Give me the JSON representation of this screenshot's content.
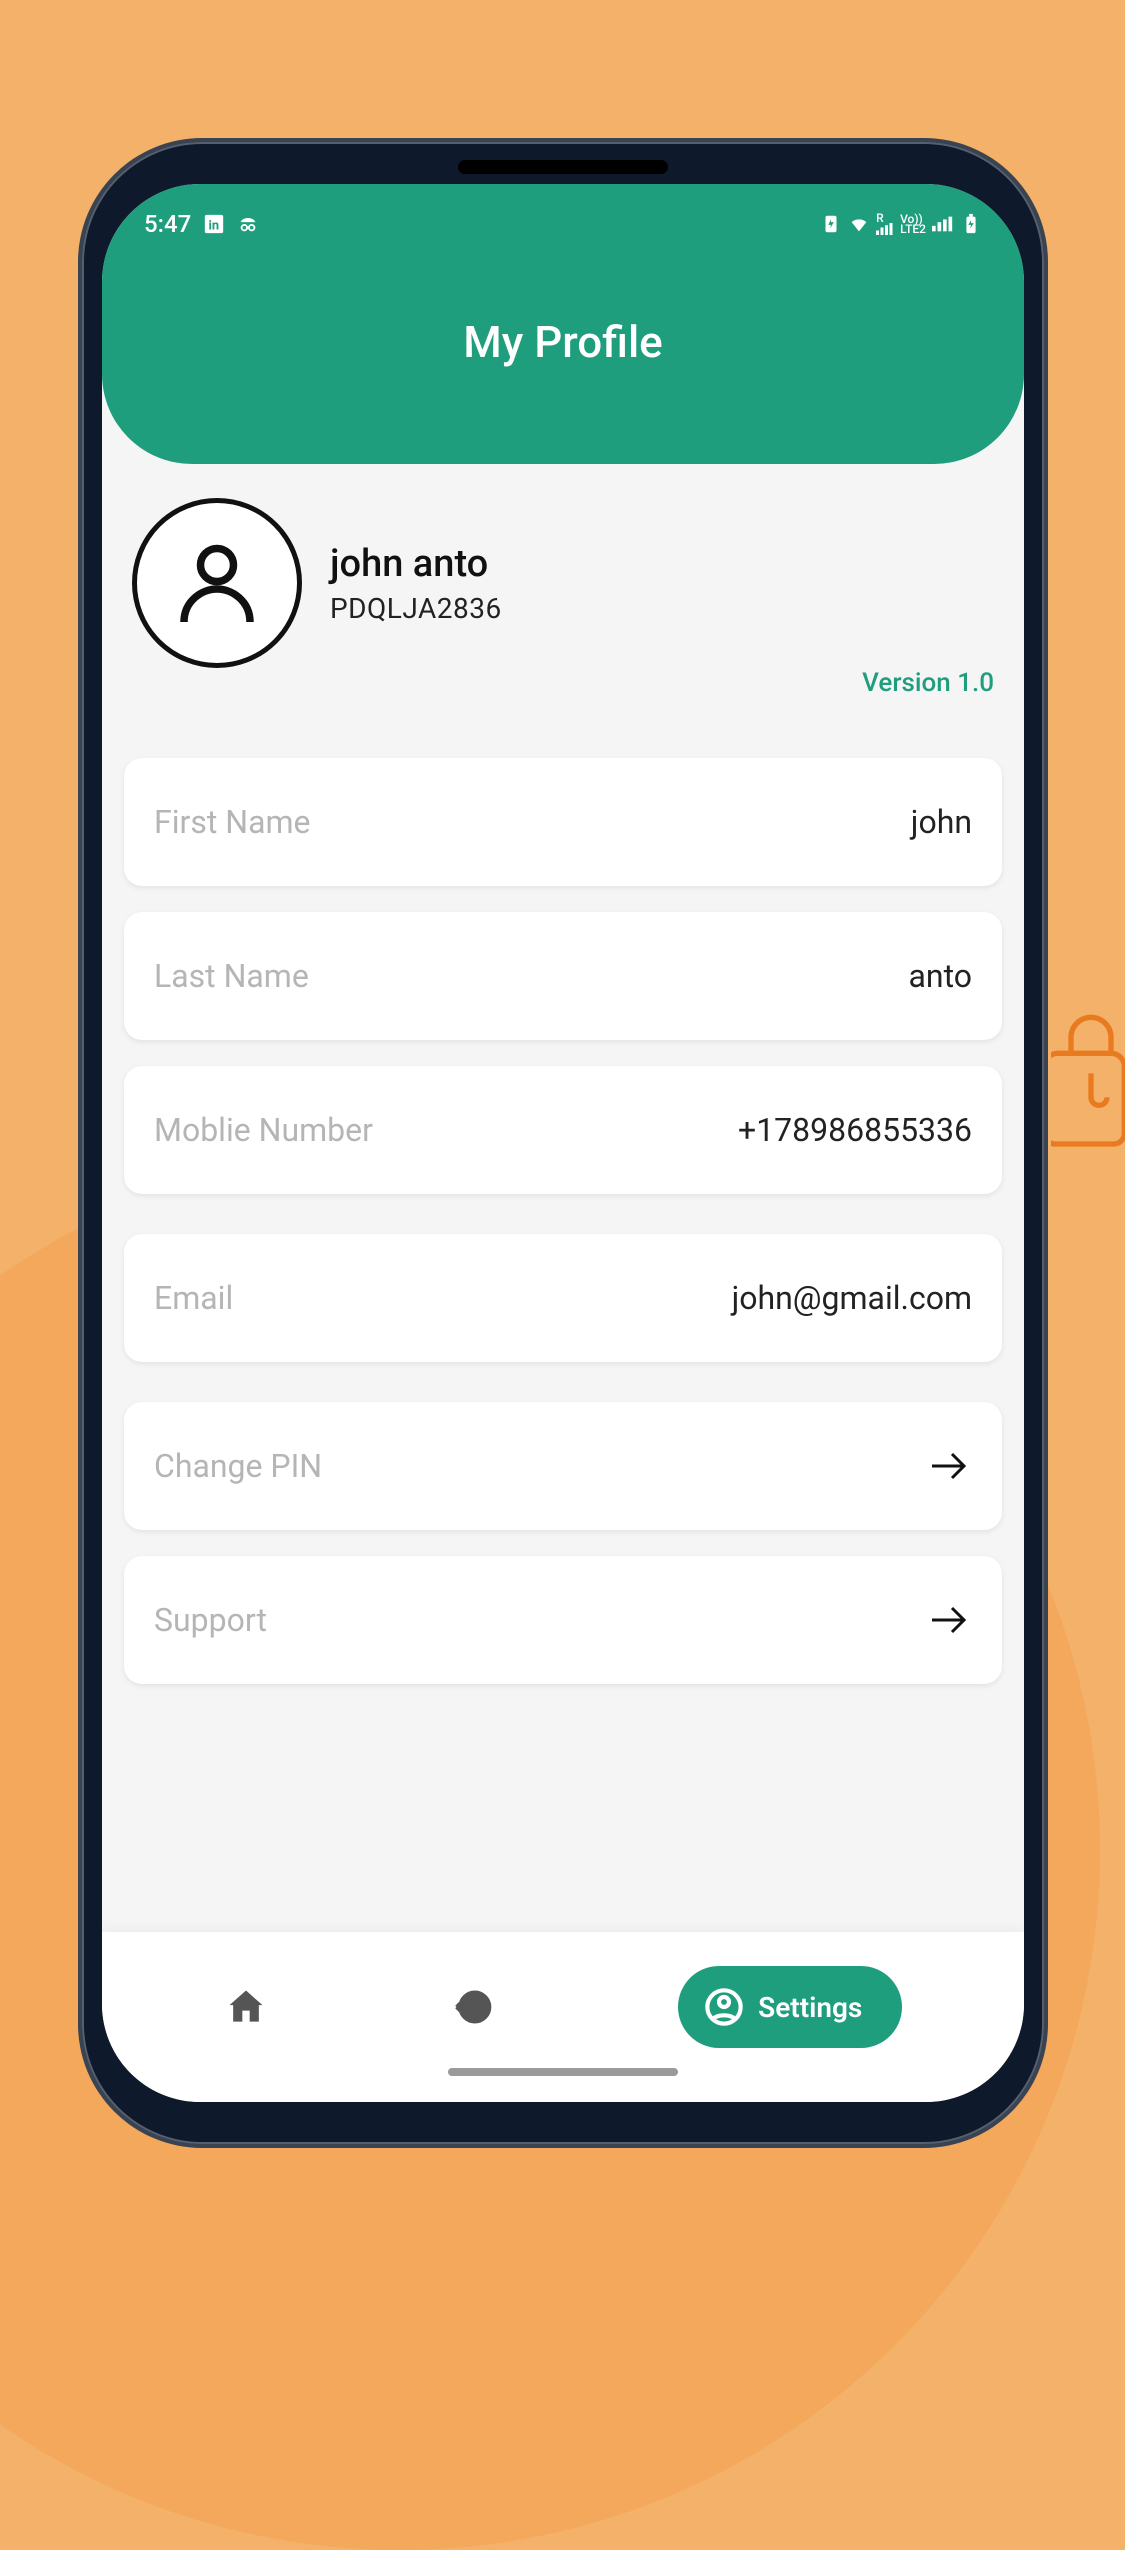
{
  "status": {
    "time": "5:47",
    "icons_left": [
      "linkedin-icon",
      "incognito-icon"
    ],
    "icons_right": [
      "battery-saver-icon",
      "wifi-icon",
      "signal-roaming-icon",
      "lte2-volte-icon",
      "signal-icon",
      "battery-icon"
    ],
    "lte_label": "LTE2",
    "volte_label": "Vo))",
    "roam_label": "R"
  },
  "header": {
    "title": "My Profile"
  },
  "profile": {
    "name": "john anto",
    "code": "PDQLJA2836",
    "version": "Version 1.0"
  },
  "fields": {
    "first_name": {
      "label": "First Name",
      "value": "john"
    },
    "last_name": {
      "label": "Last Name",
      "value": "anto"
    },
    "mobile": {
      "label": "Moblie Number",
      "value": "+178986855336"
    },
    "email": {
      "label": "Email",
      "value": "john@gmail.com"
    },
    "change_pin": {
      "label": "Change PIN"
    },
    "support": {
      "label": "Support"
    }
  },
  "nav": {
    "home": "Home",
    "history": "History",
    "settings": "Settings"
  },
  "colors": {
    "accent": "#1f9e7e",
    "bg": "#f3b169"
  }
}
